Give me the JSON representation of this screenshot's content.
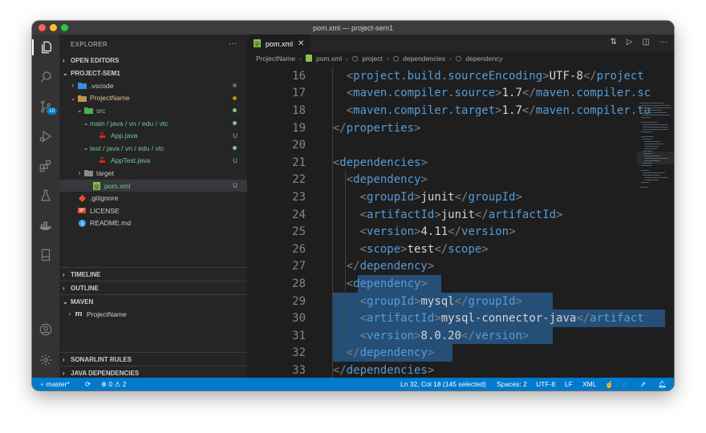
{
  "window": {
    "title": "pom.xml — project-sem1"
  },
  "activity_bar": {
    "items": [
      "files-icon",
      "search-icon",
      "source-control-icon",
      "run-debug-icon",
      "extensions-icon",
      "testing-icon",
      "docker-icon",
      "notebook-icon"
    ],
    "scm_badge": "10",
    "bottom": [
      "account-icon",
      "settings-gear-icon"
    ]
  },
  "sidebar": {
    "title": "EXPLORER",
    "more": "···",
    "open_editors": "OPEN EDITORS",
    "project": "PROJECT-SEM1",
    "tree": [
      {
        "label": ".vscode",
        "color": "#cccccc"
      },
      {
        "label": "ProjectName",
        "color": "#e2c08d"
      },
      {
        "label": "src",
        "color": "#73c991"
      },
      {
        "label": "main / java / vn / edu / vtc",
        "color": "#73c991"
      },
      {
        "label": "App.java",
        "color": "#73c991",
        "badge": "U"
      },
      {
        "label": "test / java / vn / edu / vtc",
        "color": "#73c991"
      },
      {
        "label": "AppTest.java",
        "color": "#73c991",
        "badge": "U"
      },
      {
        "label": "target",
        "color": "#cccccc"
      },
      {
        "label": "pom.xml",
        "color": "#73c991",
        "badge": "U"
      },
      {
        "label": ".gitignore",
        "color": "#cccccc"
      },
      {
        "label": "LICENSE",
        "color": "#cccccc"
      },
      {
        "label": "README.md",
        "color": "#cccccc"
      }
    ],
    "timeline": "TIMELINE",
    "outline": "OUTLINE",
    "maven": "MAVEN",
    "maven_project": "ProjectName",
    "sonarlint": "SONARLINT RULES",
    "java_deps": "JAVA DEPENDENCIES"
  },
  "editor": {
    "tab": "pom.xml",
    "tab_close": "✕",
    "breadcrumb": [
      "ProjectName",
      "pom.xml",
      "project",
      "dependencies",
      "dependency"
    ],
    "lines": [
      {
        "n": "16",
        "text": "    <project.build.sourceEncoding>UTF-8</project"
      },
      {
        "n": "17",
        "text": "    <maven.compiler.source>1.7</maven.compiler.sc"
      },
      {
        "n": "18",
        "text": "    <maven.compiler.target>1.7</maven.compiler.ta"
      },
      {
        "n": "19",
        "text": "  </properties>"
      },
      {
        "n": "20",
        "text": ""
      },
      {
        "n": "21",
        "text": "  <dependencies>"
      },
      {
        "n": "22",
        "text": "    <dependency>"
      },
      {
        "n": "23",
        "text": "      <groupId>junit</groupId>"
      },
      {
        "n": "24",
        "text": "      <artifactId>junit</artifactId>"
      },
      {
        "n": "25",
        "text": "      <version>4.11</version>"
      },
      {
        "n": "26",
        "text": "      <scope>test</scope>"
      },
      {
        "n": "27",
        "text": "    </dependency>"
      },
      {
        "n": "28",
        "text": "    <dependency>"
      },
      {
        "n": "29",
        "text": "      <groupId>mysql</groupId>"
      },
      {
        "n": "30",
        "text": "      <artifactId>mysql-connector-java</artifact"
      },
      {
        "n": "31",
        "text": "      <version>8.0.20</version>"
      },
      {
        "n": "32",
        "text": "    </dependency>"
      },
      {
        "n": "33",
        "text": "  </dependencies>"
      }
    ]
  },
  "status": {
    "branch": "master*",
    "errors": "0",
    "warnings": "2",
    "position": "Ln 32, Col 18 (145 selected)",
    "spaces": "Spaces: 2",
    "encoding": "UTF-8",
    "eol": "LF",
    "language": "XML"
  }
}
